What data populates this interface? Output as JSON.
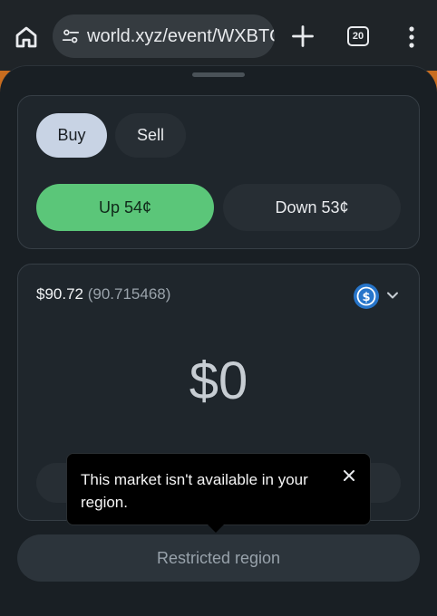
{
  "browser": {
    "url": "world.xyz/event/WXBTC",
    "tab_count": "20",
    "icons": {
      "home": "home-icon",
      "site_settings": "tune-icon",
      "new_tab": "plus-icon",
      "tabs": "tab-switcher-icon",
      "menu": "more-vert-icon"
    }
  },
  "trade": {
    "tabs": [
      {
        "label": "Buy",
        "selected": true
      },
      {
        "label": "Sell",
        "selected": false
      }
    ],
    "outcomes": {
      "up_label": "Up 54¢",
      "down_label": "Down 53¢"
    },
    "balance": "$90.72",
    "balance_precise": "(90.715468)",
    "currency_icon": "usdc-icon",
    "amount": "$0",
    "tooltip": {
      "text": "This market isn't available in your region."
    },
    "submit_label": "Restricted region"
  },
  "colors": {
    "accent_green": "#5bc679",
    "buy_selected": "#c8d3e4",
    "backdrop_orange": "#c96d1f",
    "usdc_blue": "#2775ca"
  }
}
